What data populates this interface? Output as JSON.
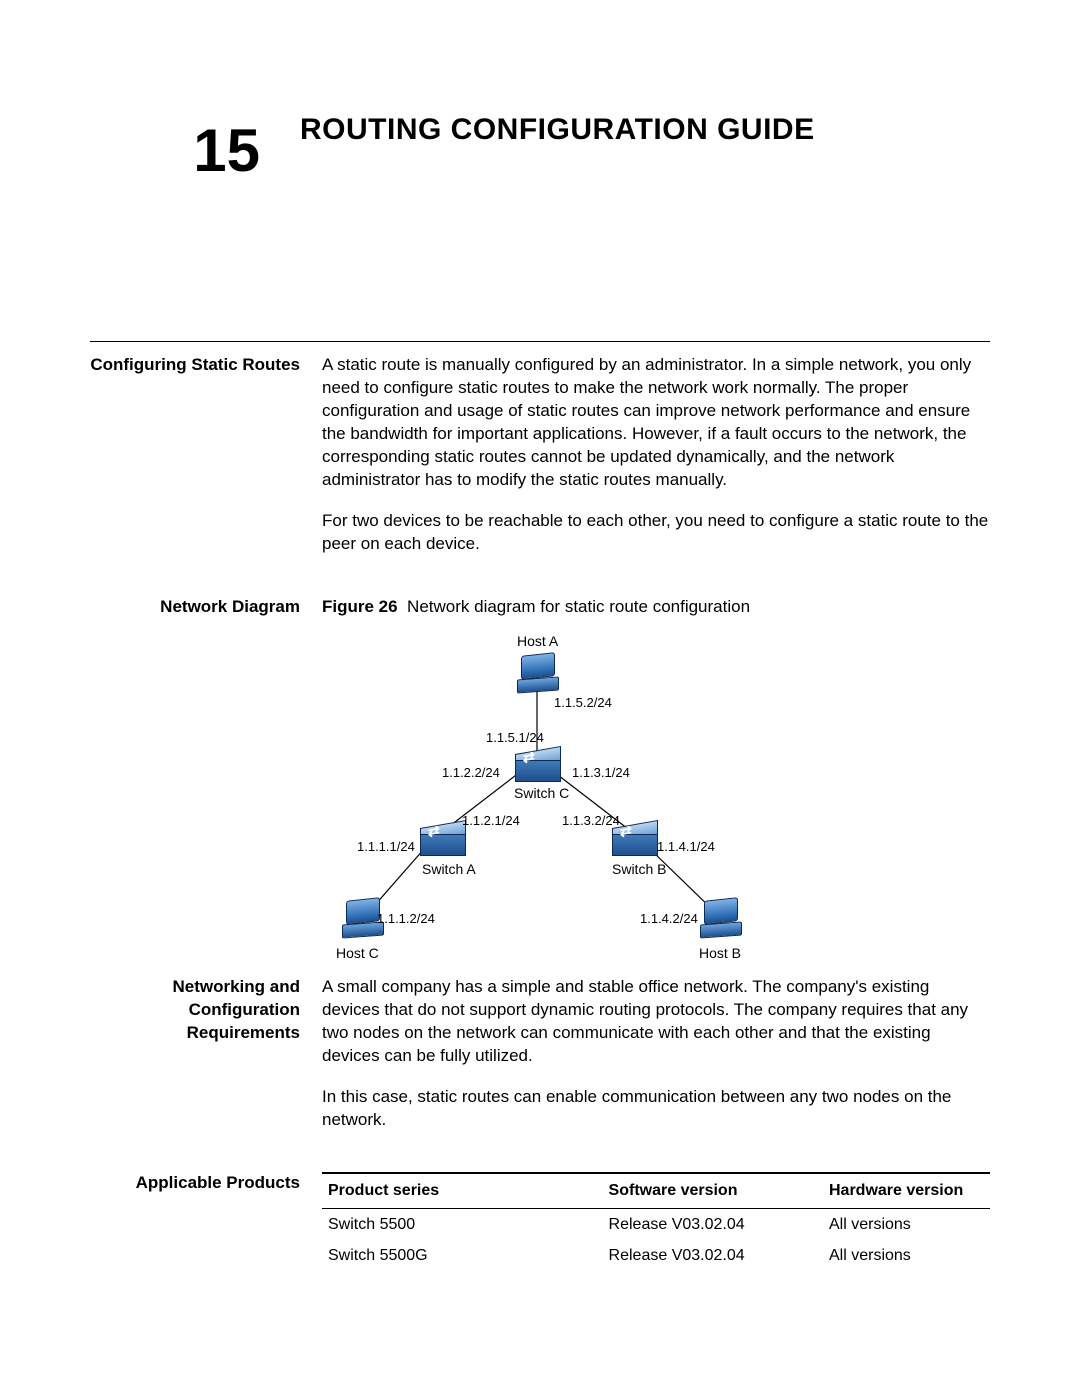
{
  "chapter": {
    "number": "15",
    "title": "ROUTING CONFIGURATION GUIDE"
  },
  "section1": {
    "heading": "Configuring Static Routes",
    "para1": "A static route is manually configured by an administrator. In a simple network, you only need to configure static routes to make the network work normally. The proper configuration and usage of static routes can improve network performance and ensure the bandwidth for important applications. However, if a fault occurs to the network, the corresponding static routes cannot be updated dynamically, and the network administrator has to modify the static routes manually.",
    "para2": "For two devices to be reachable to each other, you need to configure a static route to the peer on each device."
  },
  "diagram": {
    "heading": "Network Diagram",
    "caption_label": "Figure 26",
    "caption_text": "Network diagram for static route configuration",
    "nodes": {
      "hostA": "Host A",
      "hostB": "Host B",
      "hostC": "Host C",
      "switchA": "Switch A",
      "switchB": "Switch B",
      "switchC": "Switch C"
    },
    "ips": {
      "ip_1_1_5_2": "1.1.5.2/24",
      "ip_1_1_5_1": "1.1.5.1/24",
      "ip_1_1_2_2": "1.1.2.2/24",
      "ip_1_1_3_1": "1.1.3.1/24",
      "ip_1_1_2_1": "1.1.2.1/24",
      "ip_1_1_3_2": "1.1.3.2/24",
      "ip_1_1_1_1": "1.1.1.1/24",
      "ip_1_1_4_1": "1.1.4.1/24",
      "ip_1_1_1_2": "1.1.1.2/24",
      "ip_1_1_4_2": "1.1.4.2/24"
    }
  },
  "section2": {
    "heading": "Networking and Configuration Requirements",
    "para1": "A small company has a simple and stable office network. The company's existing devices that do not support dynamic routing protocols. The company requires that any two nodes on the network can communicate with each other and that the existing devices can be fully utilized.",
    "para2": "In this case, static routes can enable communication between any two nodes on the network."
  },
  "section3": {
    "heading": "Applicable Products",
    "table": {
      "headers": {
        "c1": "Product series",
        "c2": "Software version",
        "c3": "Hardware version"
      },
      "rows": [
        {
          "c1": "Switch 5500",
          "c2": "Release V03.02.04",
          "c3": "All versions"
        },
        {
          "c1": "Switch 5500G",
          "c2": "Release V03.02.04",
          "c3": "All versions"
        }
      ]
    }
  }
}
